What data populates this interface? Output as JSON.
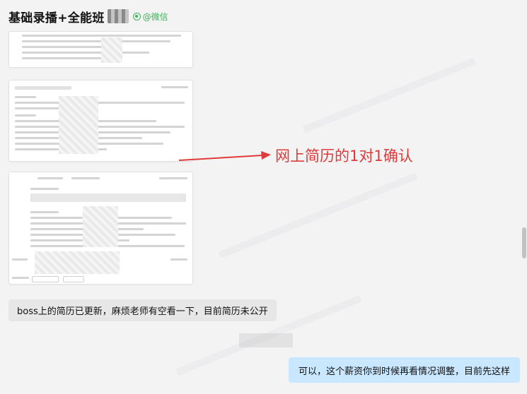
{
  "header": {
    "title": "基础录播+全能班",
    "wechat_label": "@微信"
  },
  "annotation": {
    "text": "网上简历的1对1确认"
  },
  "messages": [
    {
      "side": "left",
      "text": "boss上的简历已更新，麻烦老师有空看一下，目前简历未公开"
    },
    {
      "side": "right",
      "text": "可以，这个薪资你到时候再看情况调整，目前先这样"
    }
  ],
  "colors": {
    "annotation": "#e03a3a",
    "wechat_green": "#3fb35a",
    "bubble_self": "#c9e7ff",
    "bubble_other": "#e7e7e7"
  }
}
